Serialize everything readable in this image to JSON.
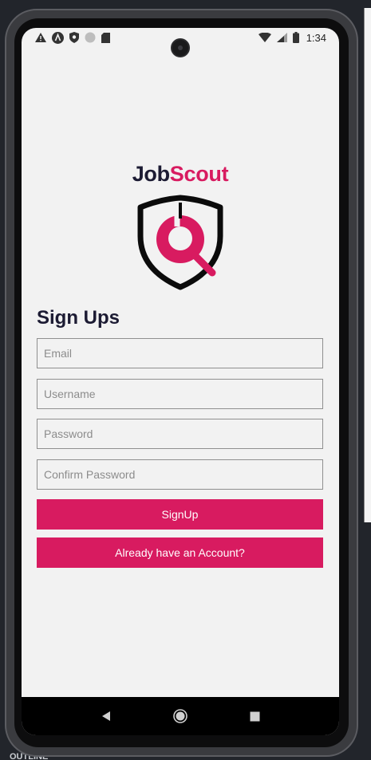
{
  "status_bar": {
    "time": "1:34",
    "left_icons": [
      "warning-icon",
      "react-native-icon",
      "shield-icon",
      "circle-icon",
      "sd-card-icon"
    ],
    "right_icons": [
      "wifi-icon",
      "cell-signal-icon",
      "battery-icon"
    ]
  },
  "brand": {
    "part1": "Job",
    "part2": "Scout",
    "color_dark": "#1c1b33",
    "color_accent": "#d81b60"
  },
  "heading": "Sign Ups",
  "form": {
    "email_placeholder": "Email",
    "username_placeholder": "Username",
    "password_placeholder": "Password",
    "confirm_placeholder": "Confirm Password"
  },
  "buttons": {
    "signup": "SignUp",
    "have_account": "Already have an Account?"
  },
  "nav": {
    "icons": [
      "back-icon",
      "home-icon",
      "recents-icon"
    ]
  },
  "background": {
    "outline_label": "OUTLINE"
  }
}
